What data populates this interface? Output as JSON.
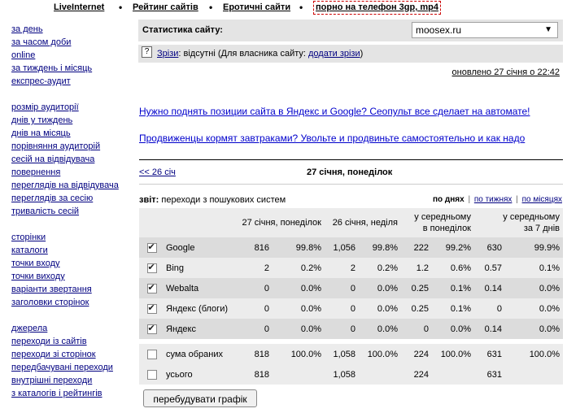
{
  "topnav": {
    "items": [
      "LiveInternet",
      "Рейтинг сайтів",
      "Еротичні сайти"
    ],
    "separator": "•",
    "ad_link": "порно на телефон 3gp, mp4"
  },
  "sidebar": {
    "group1": [
      "за день",
      "за часом доби",
      "online",
      "за тиждень і місяць",
      "експрес-аудит"
    ],
    "group2": [
      "розмір аудиторії",
      "днів у тиждень",
      "днів на місяць",
      "порівняння аудиторій",
      "сесій на відвідувача",
      "повернення",
      "переглядів на відвідувача",
      "переглядів за сесію",
      "тривалість сесій"
    ],
    "group3": [
      "сторінки",
      "каталоги",
      "точки входу",
      "точки виходу",
      "варіанти звертання",
      "заголовки сторінок"
    ],
    "group4": [
      "джерела",
      "переходи із сайтів",
      "переходи зі сторінок",
      "передбачувані переходи",
      "внутрішні переходи",
      "з каталогів і рейтингів"
    ]
  },
  "stats": {
    "title": "Статистика сайту:",
    "site": "moosex.ru",
    "help_icon": "?",
    "errors_link": "Зрізи",
    "errors_status": ": відсутні (Для власника сайту: ",
    "add_errors_link": "додати зрізи",
    "errors_close": ")",
    "updated": "оновлено 27 січня о 22:42"
  },
  "promos": [
    "Нужно поднять позиции сайта в Яндекс и Google? Сеопульт все сделает на автомате!",
    "Продвиженцы кормят завтраками? Увольте и продвиньте самостоятельно и как надо"
  ],
  "dates": {
    "prev": "<< 26 січ",
    "current": "27 січня, понеділок"
  },
  "report": {
    "label": "звіт:",
    "text": " переходи з пошукових систем",
    "period_active": "по днях",
    "period_week": "по тижнях",
    "period_month": "по місяцях",
    "period_sep": "|"
  },
  "table": {
    "headers": [
      "27 січня, понеділок",
      "26 січня, неділя",
      "у середньому\nв понеділок",
      "у середньому\nза 7 днів"
    ],
    "rows": [
      {
        "name": "Google",
        "checked": true,
        "v1": "816",
        "p1": "99.8%",
        "v2": "1,056",
        "p2": "99.8%",
        "v3": "222",
        "p3": "99.2%",
        "v4": "630",
        "p4": "99.9%"
      },
      {
        "name": "Bing",
        "checked": true,
        "v1": "2",
        "p1": "0.2%",
        "v2": "2",
        "p2": "0.2%",
        "v3": "1.2",
        "p3": "0.6%",
        "v4": "0.57",
        "p4": "0.1%"
      },
      {
        "name": "Webalta",
        "checked": true,
        "v1": "0",
        "p1": "0.0%",
        "v2": "0",
        "p2": "0.0%",
        "v3": "0.25",
        "p3": "0.1%",
        "v4": "0.14",
        "p4": "0.0%"
      },
      {
        "name": "Яндекс (блоги)",
        "checked": true,
        "v1": "0",
        "p1": "0.0%",
        "v2": "0",
        "p2": "0.0%",
        "v3": "0.25",
        "p3": "0.1%",
        "v4": "0",
        "p4": "0.0%"
      },
      {
        "name": "Яндекс",
        "checked": true,
        "v1": "0",
        "p1": "0.0%",
        "v2": "0",
        "p2": "0.0%",
        "v3": "0",
        "p3": "0.0%",
        "v4": "0.14",
        "p4": "0.0%"
      }
    ],
    "sum_row": {
      "name": "сума обраних",
      "checked": false,
      "v1": "818",
      "p1": "100.0%",
      "v2": "1,058",
      "p2": "100.0%",
      "v3": "224",
      "p3": "100.0%",
      "v4": "631",
      "p4": "100.0%"
    },
    "total_row": {
      "name": "усього",
      "checked": false,
      "v1": "818",
      "v2": "1,058",
      "v3": "224",
      "v4": "631"
    }
  },
  "rebuild_button": "перебудувати графік"
}
